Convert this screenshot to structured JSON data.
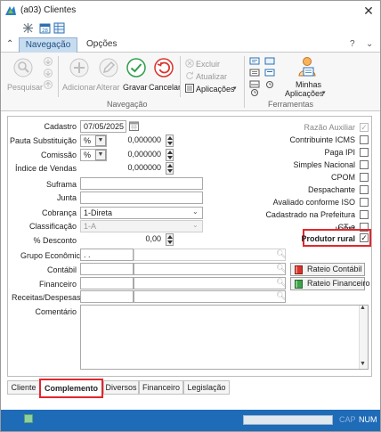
{
  "window": {
    "title": "(a03)  Clientes",
    "close_glyph": "✕"
  },
  "quick_access": [
    "settings-icon",
    "calendar-icon",
    "grid-icon"
  ],
  "ribbon": {
    "collapse_glyph": "⌃",
    "tabs": [
      {
        "label": "Navegação",
        "active": true
      },
      {
        "label": "Opções",
        "active": false
      }
    ],
    "help_glyph": "?",
    "help_chevron": "⌄",
    "groups": [
      {
        "name": "Navegação",
        "buttons": [
          {
            "label": "Pesquisar",
            "icon": "magnifier-icon",
            "enabled": false
          },
          {
            "label": "Adicionar",
            "icon": "plus-circle-icon",
            "enabled": false
          },
          {
            "label": "Alterar",
            "icon": "pencil-icon",
            "enabled": false
          },
          {
            "label": "Gravar",
            "icon": "check-circle-icon",
            "enabled": true
          },
          {
            "label": "Cancelar",
            "icon": "undo-circle-icon",
            "enabled": true
          }
        ],
        "small_buttons": [
          {
            "label": "Excluir",
            "icon": "delete-icon",
            "enabled": false
          },
          {
            "label": "Atualizar",
            "icon": "refresh-icon",
            "enabled": false
          },
          {
            "label": "Aplicações",
            "icon": "apps-icon",
            "enabled": true
          }
        ]
      },
      {
        "name": "Ferramentas",
        "buttons": [
          {
            "label": "Minhas",
            "icon": "user-apps-icon",
            "enabled": true
          },
          {
            "label": "Aplicações",
            "icon": "",
            "enabled": true
          }
        ]
      }
    ]
  },
  "form": {
    "fields": {
      "cadastro": {
        "label": "Cadastro",
        "value": "07/05/2025"
      },
      "pauta_substituicao": {
        "label": "Pauta Substituição",
        "unit": "%",
        "value": "0,000000"
      },
      "comissao": {
        "label": "Comissão",
        "unit": "%",
        "value": "0,000000"
      },
      "indice_vendas": {
        "label": "Índice de Vendas",
        "value": "0,000000"
      },
      "suframa": {
        "label": "Suframa",
        "value": ""
      },
      "junta": {
        "label": "Junta",
        "value": ""
      },
      "cobranca": {
        "label": "Cobrança",
        "value": "1-Direta"
      },
      "classificacao": {
        "label": "Classificação",
        "value": "1-A"
      },
      "desconto": {
        "label": "% Desconto",
        "value": "0,00"
      },
      "grupo_economico": {
        "label": "Grupo Econômico",
        "value": ". ."
      },
      "contabil": {
        "label": "Contábil",
        "value": ""
      },
      "financeiro": {
        "label": "Financeiro",
        "value": ""
      },
      "receitas_despesas": {
        "label": "Receitas/Despesas II",
        "value": ""
      },
      "comentario": {
        "label": "Comentário",
        "value": ""
      }
    },
    "checkboxes": [
      {
        "label": "Razão Auxiliar",
        "checked": true,
        "enabled": false
      },
      {
        "label": "Contribuinte ICMS",
        "checked": false,
        "enabled": true
      },
      {
        "label": "Paga IPI",
        "checked": false,
        "enabled": true
      },
      {
        "label": "Simples Nacional",
        "checked": false,
        "enabled": true
      },
      {
        "label": "CPOM",
        "checked": false,
        "enabled": true
      },
      {
        "label": "Despachante",
        "checked": false,
        "enabled": true
      },
      {
        "label": "Avaliado conforme ISO",
        "checked": false,
        "enabled": true
      },
      {
        "label": "Cadastrado na Prefeitura",
        "checked": false,
        "enabled": true
      },
      {
        "label": "CT-e",
        "checked": false,
        "enabled": true
      },
      {
        "label": "ICPM",
        "checked": false,
        "enabled": true
      },
      {
        "label": "Produtor rural",
        "checked": true,
        "enabled": true
      }
    ],
    "check_glyph": "✓",
    "buttons": {
      "rateio_contabil": "Rateio Contábil",
      "rateio_financeiro": "Rateio Financeiro"
    }
  },
  "bottom_tabs": [
    {
      "label": "Cliente",
      "active": false
    },
    {
      "label": "Complemento",
      "active": true
    },
    {
      "label": "Diversos",
      "active": false
    },
    {
      "label": "Financeiro",
      "active": false
    },
    {
      "label": "Legislação",
      "active": false
    }
  ],
  "status": {
    "cap": "CAP",
    "num": "NUM"
  },
  "colors": {
    "accent": "#1e6bb8",
    "highlight": "#e3262d",
    "tab_active": "#c7dcef"
  }
}
